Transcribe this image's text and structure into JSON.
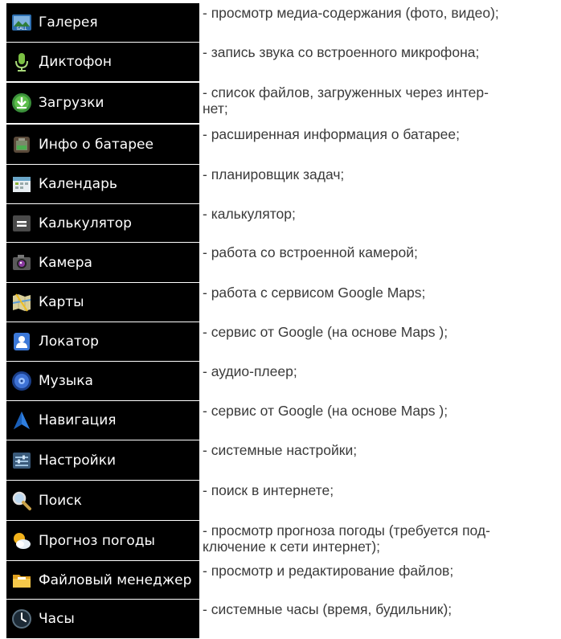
{
  "items": [
    {
      "id": "gallery",
      "label": "Галерея",
      "desc": "- просмотр медиа-содержания (фото, видео);",
      "icon": "gallery-icon"
    },
    {
      "id": "recorder",
      "label": "Диктофон",
      "desc": "- запись звука со встроенного микрофона;",
      "icon": "microphone-icon"
    },
    {
      "id": "downloads",
      "label": "Загрузки",
      "desc": "- список файлов, загруженных через интер-\n  нет;",
      "icon": "download-icon"
    },
    {
      "id": "battery-info",
      "label": "Инфо о батарее",
      "desc": "- расширенная информация о батарее;",
      "icon": "battery-icon"
    },
    {
      "id": "calendar",
      "label": "Календарь",
      "desc": "- планировщик задач;",
      "icon": "calendar-icon"
    },
    {
      "id": "calculator",
      "label": "Калькулятор",
      "desc": "- калькулятор;",
      "icon": "calculator-icon"
    },
    {
      "id": "camera",
      "label": "Камера",
      "desc": "- работа со встроенной камерой;",
      "icon": "camera-icon"
    },
    {
      "id": "maps",
      "label": "Карты",
      "desc": "- работа с сервисом Google Maps;",
      "icon": "map-icon"
    },
    {
      "id": "latitude",
      "label": "Локатор",
      "desc": "- сервис от Google (на основе Maps );",
      "icon": "locator-icon"
    },
    {
      "id": "music",
      "label": "Музыка",
      "desc": "- аудио-плеер;",
      "icon": "music-icon"
    },
    {
      "id": "navigation",
      "label": "Навигация",
      "desc": "- сервис от Google (на основе Maps );",
      "icon": "navigation-arrow-icon"
    },
    {
      "id": "settings",
      "label": "Настройки",
      "desc": "- системные настройки;",
      "icon": "settings-icon"
    },
    {
      "id": "search",
      "label": "Поиск",
      "desc": "- поиск в интернете;",
      "icon": "search-icon"
    },
    {
      "id": "weather",
      "label": "Прогноз погоды",
      "desc": "- просмотр прогноза погоды (требуется под-\n  ключение к сети интернет);",
      "icon": "weather-icon"
    },
    {
      "id": "file-manager",
      "label": "Файловый менеджер",
      "desc": "- просмотр и редактирование файлов;",
      "icon": "folder-icon"
    },
    {
      "id": "clock",
      "label": "Часы",
      "desc": "- системные часы (время, будильник);",
      "icon": "clock-icon"
    }
  ]
}
